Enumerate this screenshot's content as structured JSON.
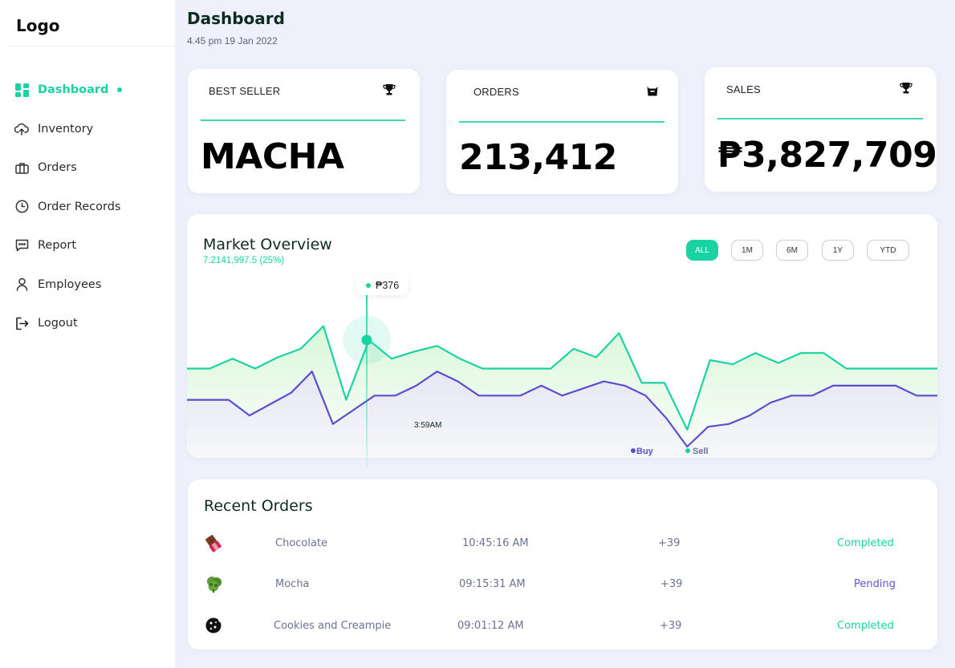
{
  "sidebar": {
    "logo": "Logo",
    "items": [
      {
        "label": "Dashboard",
        "icon": "dashboard-grid-icon",
        "active": true
      },
      {
        "label": "Inventory",
        "icon": "cloud-upload-icon"
      },
      {
        "label": "Orders",
        "icon": "briefcase-icon"
      },
      {
        "label": "Order Records",
        "icon": "clock-icon"
      },
      {
        "label": "Report",
        "icon": "chat-icon"
      },
      {
        "label": "Employees",
        "icon": "user-icon"
      },
      {
        "label": "Logout",
        "icon": "logout-icon"
      }
    ]
  },
  "header": {
    "title": "Dashboard",
    "datetime": "4.45 pm 19 Jan 2022"
  },
  "stats": {
    "best_seller": {
      "label": "BEST SELLER",
      "value": "MACHA",
      "icon": "trophy-icon"
    },
    "orders": {
      "label": "ORDERS",
      "value": "213,412",
      "icon": "bag-icon"
    },
    "sales": {
      "label": "SALES",
      "value": "₱3,827,709",
      "icon": "trophy-icon"
    }
  },
  "market": {
    "title": "Market Overview",
    "subtitle": "7.2141,997.5 (25%)",
    "ranges": [
      "ALL",
      "1M",
      "6M",
      "1Y",
      "YTD"
    ],
    "active_range": "ALL",
    "tooltip_value": "₱376",
    "time_label": "3:59AM",
    "legend_buy": "Buy",
    "legend_sell": "Sell"
  },
  "chart_data": {
    "type": "area",
    "title": "Market Overview",
    "series": [
      {
        "name": "Sell",
        "color": "#19d3a2",
        "values": [
          0.55,
          0.55,
          0.62,
          0.55,
          0.63,
          0.69,
          0.85,
          0.33,
          0.75,
          0.62,
          0.67,
          0.71,
          0.62,
          0.55,
          0.55,
          0.55,
          0.55,
          0.69,
          0.63,
          0.8,
          0.45,
          0.45,
          0.12,
          0.61,
          0.58,
          0.66,
          0.59,
          0.66,
          0.66,
          0.55,
          0.55,
          0.55,
          0.55,
          0.55
        ]
      },
      {
        "name": "Buy",
        "color": "#5b4fcf",
        "values": [
          0.33,
          0.33,
          0.33,
          0.22,
          0.3,
          0.38,
          0.53,
          0.16,
          0.26,
          0.36,
          0.36,
          0.43,
          0.53,
          0.46,
          0.36,
          0.36,
          0.36,
          0.43,
          0.36,
          0.41,
          0.46,
          0.43,
          0.36,
          0.2,
          0.0,
          0.14,
          0.16,
          0.22,
          0.31,
          0.36,
          0.36,
          0.43,
          0.43,
          0.43,
          0.43,
          0.36,
          0.36
        ]
      }
    ]
  },
  "recent_orders": {
    "title": "Recent Orders",
    "rows": [
      {
        "item": "Chocolate",
        "time": "10:45:16 AM",
        "qty": "+39",
        "status": "Completed",
        "icon": "chocolate-icon"
      },
      {
        "item": "Mocha",
        "time": "09:15:31 AM",
        "qty": "+39",
        "status": "Pending",
        "icon": "mocha-icon"
      },
      {
        "item": "Cookies and Creampie",
        "time": "09:01:12 AM",
        "qty": "+39",
        "status": "Completed",
        "icon": "cookie-icon"
      }
    ]
  }
}
